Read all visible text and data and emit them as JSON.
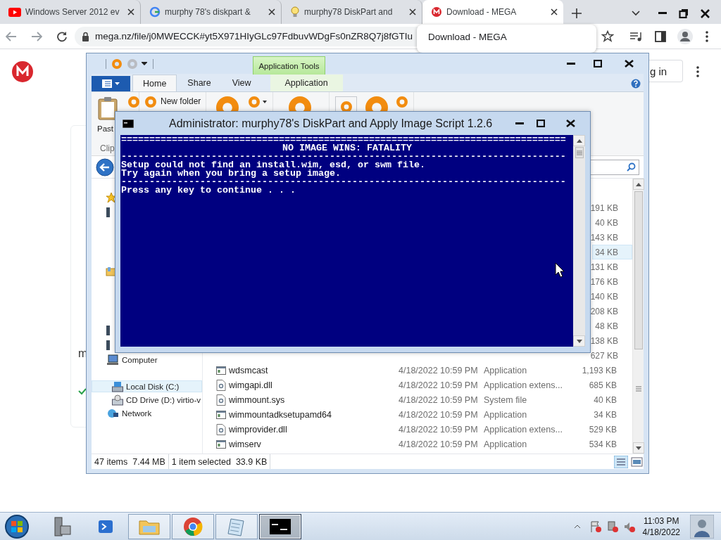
{
  "browser": {
    "tabs": [
      {
        "title": "Windows Server 2012 ev",
        "kind": "video",
        "selected": false
      },
      {
        "title": "murphy 78's diskpart &",
        "kind": "search",
        "selected": false
      },
      {
        "title": "murphy78 DiskPart and",
        "kind": "bulb",
        "selected": false
      },
      {
        "title": "Download - MEGA",
        "kind": "mega",
        "selected": true
      }
    ],
    "url": "mega.nz/file/j0MWECCK#yt5X971HIyGLc97FdbuvWDgFs0nZR8Q7j8fGTIu",
    "hover_card": {
      "title": "Download - MEGA"
    },
    "page": {
      "sign_in_button": "g in",
      "partial_text": "m"
    }
  },
  "explorer": {
    "context_tab": "Application Tools",
    "tabs": [
      {
        "label": "Home",
        "selected": true
      },
      {
        "label": "Share",
        "selected": false
      },
      {
        "label": "View",
        "selected": false
      },
      {
        "label": "Application",
        "selected": false
      }
    ],
    "ribbon": {
      "paste_label": "Past",
      "new_folder": "New folder",
      "group_label": "Clip"
    },
    "nav_pane": [
      {
        "label": "Computer",
        "selected": false,
        "children": [
          {
            "label": "Local Disk (C:)",
            "selected": true
          },
          {
            "label": "CD Drive (D:) virtio-v",
            "selected": false
          }
        ]
      },
      {
        "label": "Network",
        "selected": false
      }
    ],
    "files": [
      {
        "size": "191 KB",
        "selected": false
      },
      {
        "size": "40 KB",
        "selected": false
      },
      {
        "size": "143 KB",
        "selected": false
      },
      {
        "size": "34 KB",
        "selected": true
      },
      {
        "size": "131 KB",
        "selected": false
      },
      {
        "size": "176 KB",
        "selected": false
      },
      {
        "size": "140 KB",
        "selected": false
      },
      {
        "size": "208 KB",
        "selected": false
      },
      {
        "size": "48 KB",
        "selected": false
      },
      {
        "size": "138 KB",
        "selected": false
      },
      {
        "size": "627 KB",
        "selected": false
      },
      {
        "name": "wdsmcast",
        "kind": "application",
        "modified": "4/18/2022 10:59 PM",
        "type": "Application",
        "size": "1,193 KB",
        "selected": false
      },
      {
        "name": "wimgapi.dll",
        "kind": "extension",
        "modified": "4/18/2022 10:59 PM",
        "type": "Application extens...",
        "size": "685 KB",
        "selected": false
      },
      {
        "name": "wimmount.sys",
        "kind": "extension",
        "modified": "4/18/2022 10:59 PM",
        "type": "System file",
        "size": "40 KB",
        "selected": false
      },
      {
        "name": "wimmountadksetupamd64",
        "kind": "application",
        "modified": "4/18/2022 10:59 PM",
        "type": "Application",
        "size": "34 KB",
        "selected": false
      },
      {
        "name": "wimprovider.dll",
        "kind": "extension",
        "modified": "4/18/2022 10:59 PM",
        "type": "Application extens...",
        "size": "529 KB",
        "selected": false
      },
      {
        "name": "wimserv",
        "kind": "application",
        "modified": "4/18/2022 10:59 PM",
        "type": "Application",
        "size": "534 KB",
        "selected": false
      }
    ],
    "status": {
      "items": "47 items",
      "items_size": "7.44 MB",
      "selected": "1 item selected",
      "selected_size": "33.9 KB"
    }
  },
  "console": {
    "title": "Administrator:  murphy78's DiskPart and Apply Image Script 1.2.6",
    "lines": [
      {
        "kind": "rule",
        "text": "==============================================================================="
      },
      {
        "kind": "heading",
        "text": "NO IMAGE WINS: FATALITY"
      },
      {
        "kind": "rule",
        "text": "-------------------------------------------------------------------------------"
      },
      {
        "kind": "text",
        "text": "Setup could not find an install.wim, esd, or swm file."
      },
      {
        "kind": "text",
        "text": "Try again when you bring a setup image."
      },
      {
        "kind": "rule",
        "text": "-------------------------------------------------------------------------------"
      },
      {
        "kind": "text",
        "text": "Press any key to continue . . ."
      }
    ]
  },
  "taskbar": {
    "apps": [
      {
        "kind": "server",
        "running": false,
        "selected": false
      },
      {
        "kind": "shell",
        "running": false,
        "selected": false
      },
      {
        "kind": "folder",
        "running": true,
        "selected": false
      },
      {
        "kind": "browser",
        "running": true,
        "selected": false
      },
      {
        "kind": "notepad",
        "running": true,
        "selected": false
      },
      {
        "kind": "console",
        "running": true,
        "selected": true
      }
    ],
    "time": "11:03 PM",
    "date": "4/18/2022"
  }
}
